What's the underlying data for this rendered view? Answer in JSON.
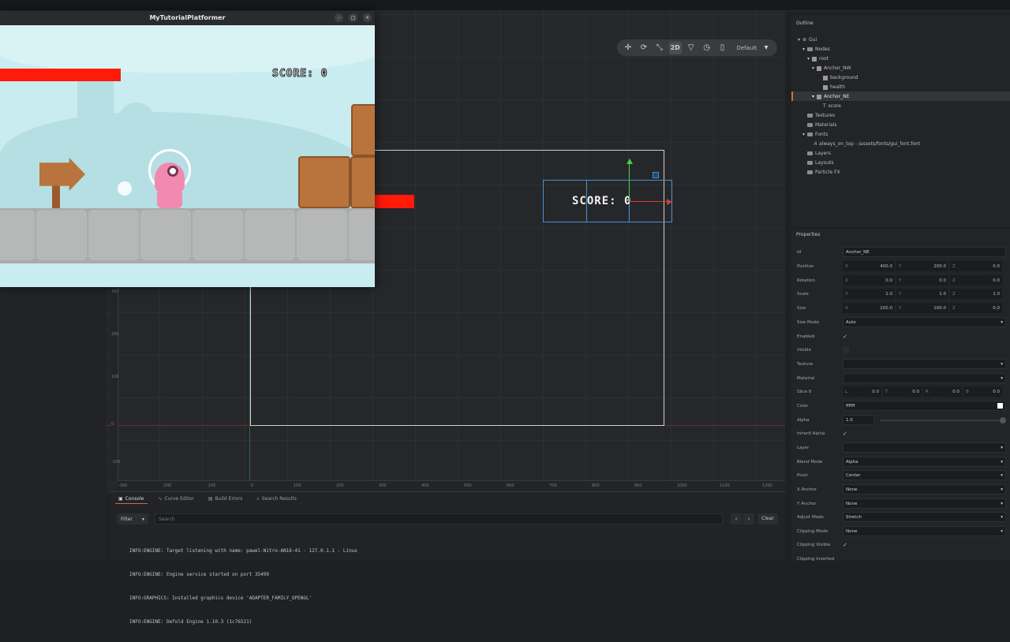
{
  "window": {
    "title": "MyTutorialPlatformer"
  },
  "game": {
    "score_text": "SCORE: 0"
  },
  "editor": {
    "toolbar": {
      "mode_label": "2D",
      "layout_label": "Default"
    },
    "node_score_text": "SCORE: 0",
    "ruler_bottom": [
      "-300",
      "-200",
      "-100",
      "0",
      "100",
      "200",
      "300",
      "400",
      "500",
      "600",
      "700",
      "800",
      "900",
      "1000",
      "1100",
      "1200"
    ],
    "ruler_left": [
      "300",
      "200",
      "100",
      "0",
      "-100"
    ]
  },
  "outline": {
    "title": "Outline",
    "items": [
      {
        "label": "Gui",
        "icon": "gui-icon"
      },
      {
        "label": "Nodes",
        "icon": "folder-icon"
      },
      {
        "label": "root",
        "icon": "box-node-icon"
      },
      {
        "label": "Anchor_NW",
        "icon": "box-node-icon"
      },
      {
        "label": "background",
        "icon": "box-node-icon"
      },
      {
        "label": "health",
        "icon": "box-node-icon"
      },
      {
        "label": "Anchor_NE",
        "icon": "box-node-icon"
      },
      {
        "label": "score",
        "icon": "text-node-icon"
      },
      {
        "label": "Textures",
        "icon": "folder-icon"
      },
      {
        "label": "Materials",
        "icon": "folder-icon"
      },
      {
        "label": "Fonts",
        "icon": "folder-icon"
      },
      {
        "label": "always_on_top - /assets/fonts/gui_font.font",
        "icon": "font-icon"
      },
      {
        "label": "Layers",
        "icon": "folder-icon"
      },
      {
        "label": "Layouts",
        "icon": "folder-icon"
      },
      {
        "label": "Particle FX",
        "icon": "folder-icon"
      }
    ]
  },
  "properties": {
    "title": "Properties",
    "id_label": "Id",
    "id_value": "Anchor_NE",
    "position": {
      "label": "Position",
      "x": "400.0",
      "y": "200.0",
      "z": "0.0"
    },
    "rotation": {
      "label": "Rotation",
      "x": "0.0",
      "y": "0.0",
      "z": "0.0"
    },
    "scale": {
      "label": "Scale",
      "x": "1.0",
      "y": "1.0",
      "z": "1.0"
    },
    "size": {
      "label": "Size",
      "x": "200.0",
      "y": "100.0",
      "z": "0.0"
    },
    "size_mode": {
      "label": "Size Mode",
      "value": "Auto"
    },
    "enabled_label": "Enabled",
    "visible_label": "Visible",
    "texture_label": "Texture",
    "material_label": "Material",
    "slice9": {
      "label": "Slice 9",
      "l": "0.0",
      "t": "0.0",
      "r": "0.0",
      "b": "0.0"
    },
    "color": {
      "label": "Color",
      "value": "ffffff"
    },
    "alpha": {
      "label": "Alpha",
      "value": "1.0"
    },
    "inherit_alpha_label": "Inherit Alpha",
    "layer_label": "Layer",
    "blend_mode": {
      "label": "Blend Mode",
      "value": "Alpha"
    },
    "pivot": {
      "label": "Pivot",
      "value": "Center"
    },
    "x_anchor": {
      "label": "X Anchor",
      "value": "None"
    },
    "y_anchor": {
      "label": "Y Anchor",
      "value": "None"
    },
    "adjust_mode": {
      "label": "Adjust Mode",
      "value": "Stretch"
    },
    "clipping_mode": {
      "label": "Clipping Mode",
      "value": "None"
    },
    "clipping_visible_label": "Clipping Visible",
    "clipping_inverted_label": "Clipping Inverted"
  },
  "bottom": {
    "tabs": [
      "Console",
      "Curve Editor",
      "Build Errors",
      "Search Results"
    ],
    "filter_label": "Filter",
    "search_placeholder": "Search",
    "clear_label": "Clear",
    "console_lines": [
      "INFO:ENGINE: Target listening with name: pawel-Nitro-AN16-41 - 127.0.1.1 - Linux",
      "INFO:ENGINE: Engine service started on port 35499",
      "INFO:GRAPHICS: Installed graphics device 'ADAPTER_FAMILY_OPENGL'",
      "INFO:ENGINE: Defold Engine 1.10.3 (1c76521)"
    ]
  },
  "colors": {
    "health_bar": "#ff1a0a",
    "accent": "#d46a4a",
    "selection": "#4a8fcf"
  }
}
